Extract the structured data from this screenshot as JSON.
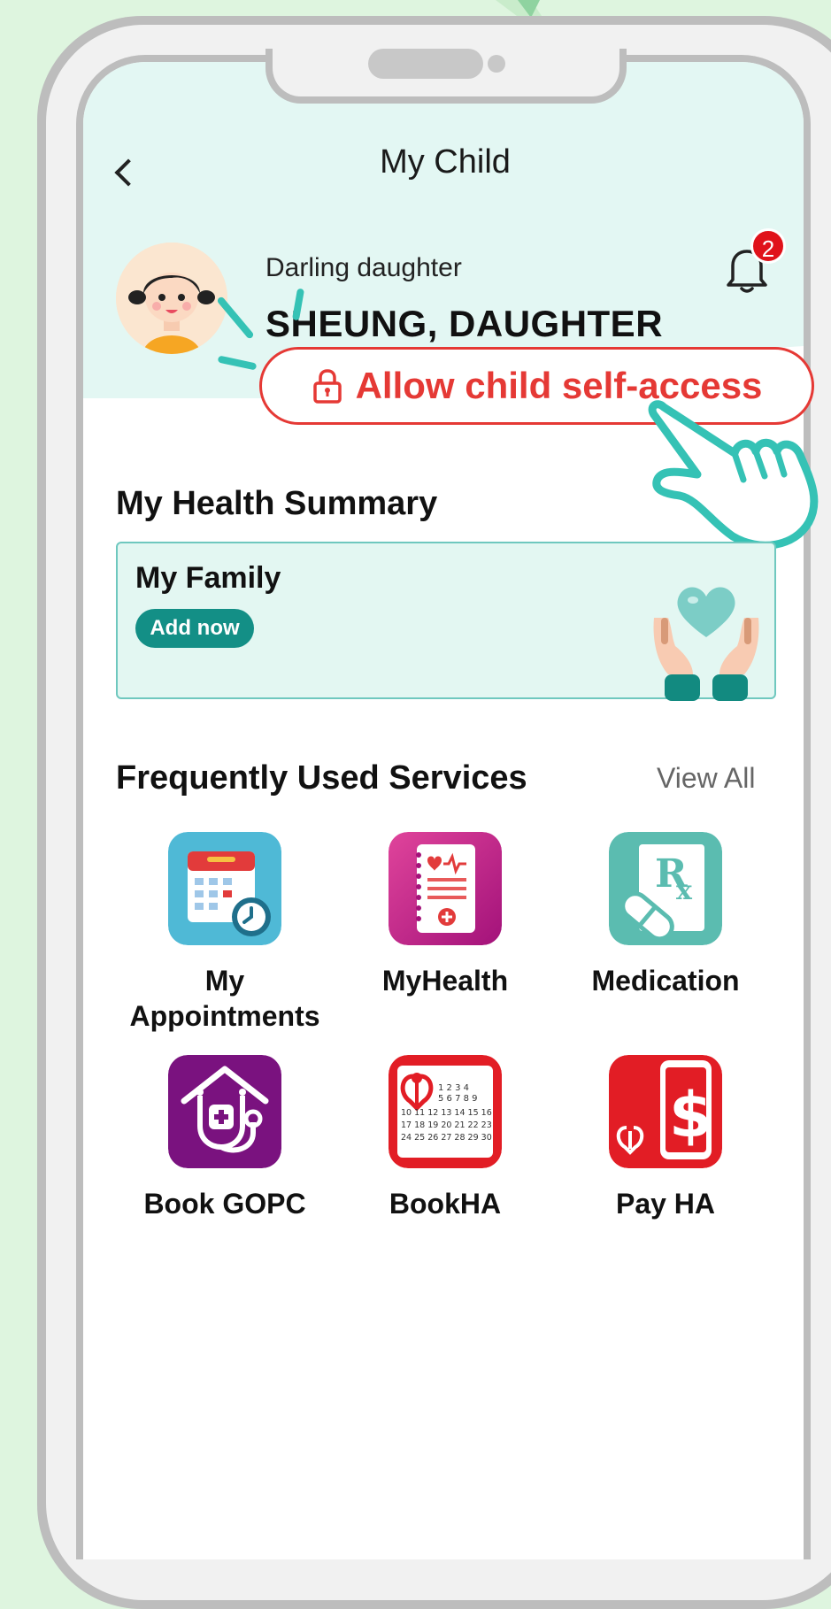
{
  "header": {
    "title": "My Child"
  },
  "profile": {
    "relation": "Darling daughter",
    "name": "SHEUNG, DAUGHTER",
    "notification_count": "2",
    "self_access_label": "Allow child self-access"
  },
  "health_summary": {
    "title": "My Health Summary",
    "card_title": "My Family",
    "add_label": "Add now"
  },
  "services": {
    "title": "Frequently Used Services",
    "view_all": "View All",
    "items": [
      {
        "label": "My\nAppointments",
        "icon": "calendar-clock-icon"
      },
      {
        "label": "MyHealth",
        "icon": "health-record-icon"
      },
      {
        "label": "Medication",
        "icon": "prescription-icon"
      },
      {
        "label": "Book GOPC",
        "icon": "clinic-stethoscope-icon"
      },
      {
        "label": "BookHA",
        "icon": "ha-calendar-icon"
      },
      {
        "label": "Pay HA",
        "icon": "pay-dollar-icon"
      }
    ]
  },
  "calendar_numbers": "1 2 3 4 5 6 7 8 9 10 11 12 13 14 15 16 17 18 19 20 21 22 23 24 25 26 27 28 29 30",
  "colors": {
    "accent_red": "#e53935",
    "teal": "#138f86",
    "screen_top": "#e3f7f3"
  }
}
